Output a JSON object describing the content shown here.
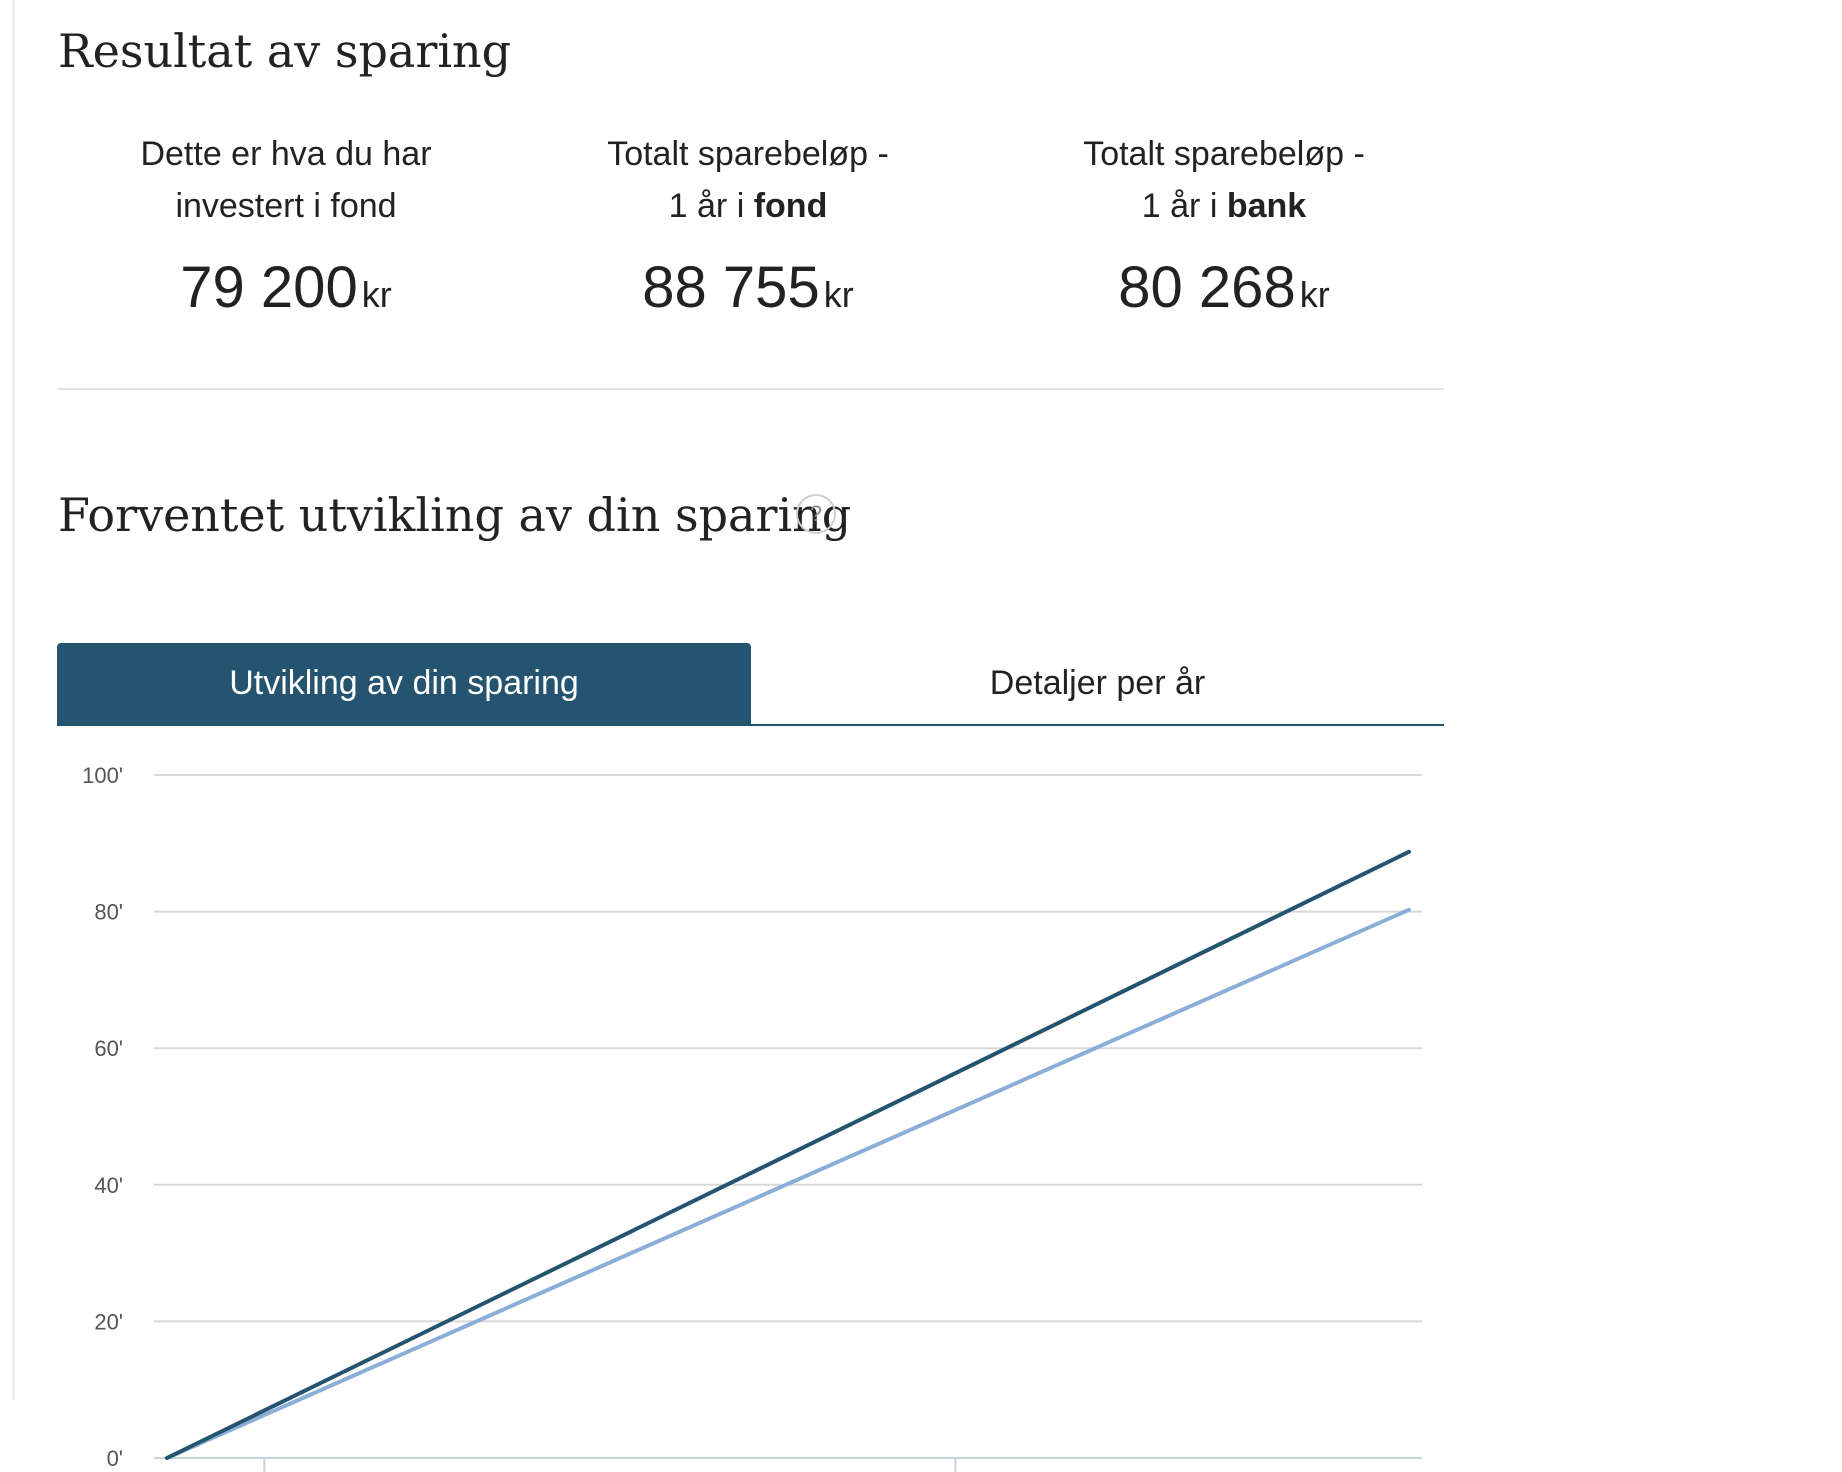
{
  "results": {
    "title": "Resultat av sparing",
    "stats": [
      {
        "line1": "Dette er hva du har",
        "line2_prefix": "investert i fond",
        "line2_bold": "",
        "value": "79 200",
        "unit": "kr"
      },
      {
        "line1": "Totalt sparebeløp -",
        "line2_prefix": "1 år i ",
        "line2_bold": "fond",
        "value": "88 755",
        "unit": "kr"
      },
      {
        "line1": "Totalt sparebeløp -",
        "line2_prefix": "1 år i ",
        "line2_bold": "bank",
        "value": "80 268",
        "unit": "kr"
      }
    ]
  },
  "development": {
    "title": "Forventet utvikling av din sparing",
    "help_label": "?"
  },
  "tabs": [
    {
      "label": "Utvikling av din sparing",
      "active": true
    },
    {
      "label": "Detaljer per år",
      "active": false
    }
  ],
  "chart_data": {
    "type": "line",
    "y_ticks": [
      "100'",
      "80'",
      "60'",
      "40'",
      "20'",
      "0'"
    ],
    "ylim": [
      0,
      100
    ],
    "xlim": [
      0,
      1
    ],
    "grid": true,
    "series": [
      {
        "x": [
          0,
          1
        ],
        "values": [
          0,
          88.755
        ],
        "color": "#24546f"
      },
      {
        "x": [
          0,
          1
        ],
        "values": [
          0,
          80.268
        ],
        "color": "#8aaed8"
      }
    ],
    "x_tick_positions": [
      0.087,
      0.632
    ]
  }
}
